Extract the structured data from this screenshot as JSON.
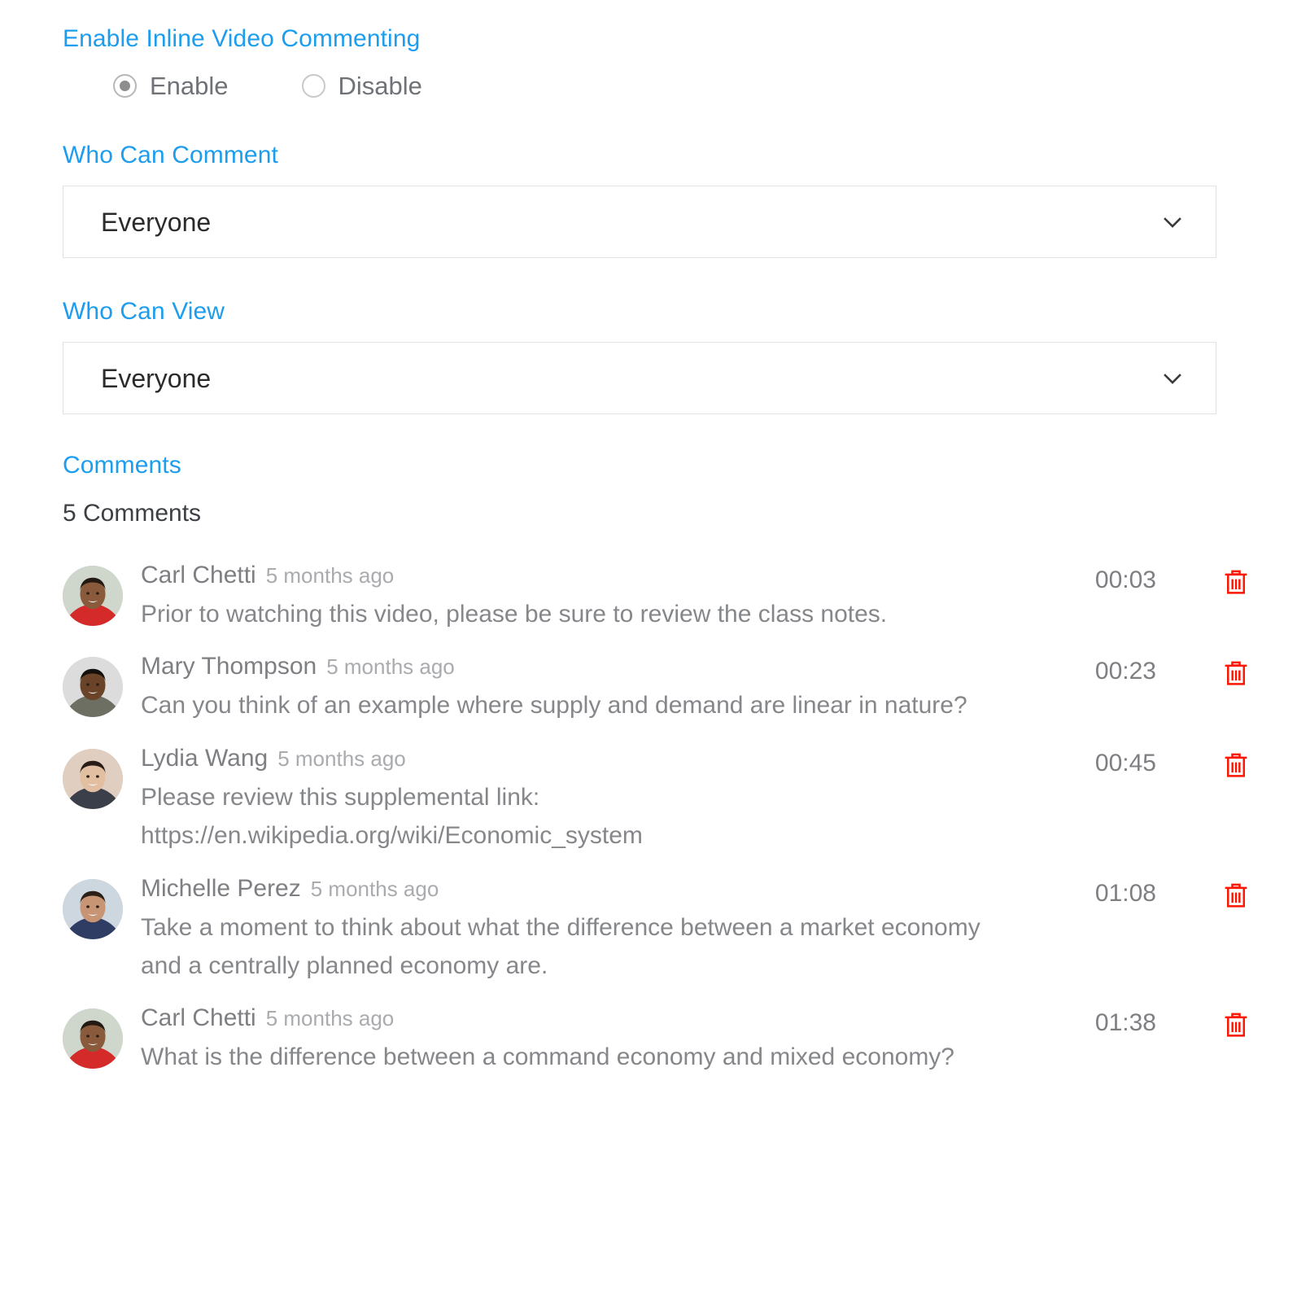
{
  "inline_commenting": {
    "label": "Enable Inline Video Commenting",
    "options": [
      {
        "label": "Enable",
        "selected": true
      },
      {
        "label": "Disable",
        "selected": false
      }
    ]
  },
  "who_can_comment": {
    "label": "Who Can Comment",
    "value": "Everyone",
    "icon": "chevron-down-icon"
  },
  "who_can_view": {
    "label": "Who Can View",
    "value": "Everyone",
    "icon": "chevron-down-icon"
  },
  "comments_section": {
    "label": "Comments",
    "count_text": "5 Comments",
    "delete_icon": "trash-icon",
    "items": [
      {
        "author": "Carl Chetti",
        "time_ago": "5 months ago",
        "text": "Prior to watching this video, please be sure to review the class notes.",
        "timestamp": "00:03",
        "avatar": "carl-chetti-avatar"
      },
      {
        "author": "Mary Thompson",
        "time_ago": "5 months ago",
        "text": "Can you think of an example where supply and demand are linear in nature?",
        "timestamp": "00:23",
        "avatar": "mary-thompson-avatar"
      },
      {
        "author": "Lydia Wang",
        "time_ago": "5 months ago",
        "text": "Please review this supplemental link: https://en.wikipedia.org/wiki/Economic_system",
        "timestamp": "00:45",
        "avatar": "lydia-wang-avatar"
      },
      {
        "author": "Michelle Perez",
        "time_ago": "5 months ago",
        "text": "Take a moment to think about what the difference between a market economy and a centrally planned economy are.",
        "timestamp": "01:08",
        "avatar": "michelle-perez-avatar"
      },
      {
        "author": "Carl Chetti",
        "time_ago": "5 months ago",
        "text": "What is the difference between a command economy and mixed economy?",
        "timestamp": "01:38",
        "avatar": "carl-chetti-avatar"
      }
    ]
  },
  "colors": {
    "label_blue": "#1c9ded",
    "delete_red": "#ff1500",
    "text_gray": "#85878b",
    "border_gray": "#e2e2e2"
  }
}
